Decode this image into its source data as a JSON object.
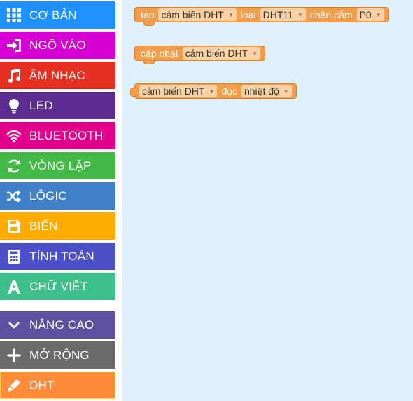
{
  "toolbox": {
    "categories": [
      {
        "label": "CƠ BẢN",
        "color": "#1e90ff",
        "icon": "grid-icon"
      },
      {
        "label": "NGÕ VÀO",
        "color": "#d400d4",
        "icon": "sign-in-icon"
      },
      {
        "label": "ÂM NHẠC",
        "color": "#e63022",
        "icon": "music-note-icon"
      },
      {
        "label": "LED",
        "color": "#5c2d91",
        "icon": "lightbulb-icon"
      },
      {
        "label": "BLUETOOTH",
        "color": "#e3008c",
        "icon": "wifi-icon"
      },
      {
        "label": "VÒNG LẶP",
        "color": "#43b947",
        "icon": "refresh-icon"
      },
      {
        "label": "LÔGIC",
        "color": "#3f80c8",
        "icon": "shuffle-icon"
      },
      {
        "label": "BIẾN",
        "color": "#ffab00",
        "icon": "save-icon"
      },
      {
        "label": "TÍNH TOÁN",
        "color": "#4b50c8",
        "icon": "calculator-icon"
      },
      {
        "label": "CHỮ VIẾT",
        "color": "#3fbf8a",
        "icon": "text-a-icon"
      },
      {
        "label": "NÂNG CAO",
        "color": "#5e4fa0",
        "icon": "chevron-down-icon"
      },
      {
        "label": "MỞ RỘNG",
        "color": "#6b6b6b",
        "icon": "plus-icon"
      },
      {
        "label": "DHT",
        "color": "#ff8c3a",
        "icon": "pen-icon"
      }
    ]
  },
  "blocks": {
    "create": {
      "w1": "tạo",
      "d1": "cảm biến DHT",
      "w2": "loại",
      "d2": "DHT11",
      "w3": "chân cắm",
      "d3": "P0"
    },
    "update": {
      "w1": "cập nhật",
      "d1": "cảm biến DHT"
    },
    "read": {
      "d1": "cảm biến DHT",
      "w1": "đọc",
      "d2": "nhiệt độ"
    }
  },
  "colors": {
    "block": "#f39c4a",
    "workspace": "#dff1fb"
  }
}
